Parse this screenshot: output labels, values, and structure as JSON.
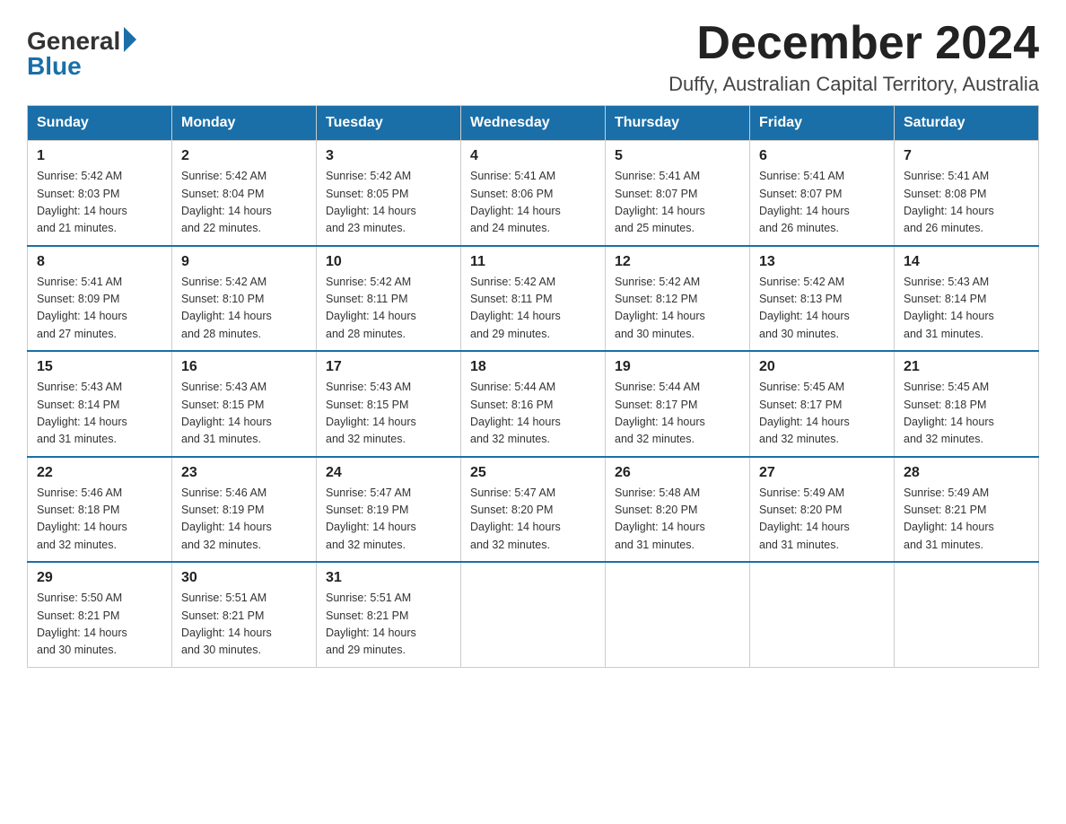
{
  "logo": {
    "general": "General",
    "blue": "Blue"
  },
  "title": "December 2024",
  "location": "Duffy, Australian Capital Territory, Australia",
  "days_of_week": [
    "Sunday",
    "Monday",
    "Tuesday",
    "Wednesday",
    "Thursday",
    "Friday",
    "Saturday"
  ],
  "weeks": [
    [
      {
        "day": "1",
        "sunrise": "5:42 AM",
        "sunset": "8:03 PM",
        "daylight": "14 hours and 21 minutes."
      },
      {
        "day": "2",
        "sunrise": "5:42 AM",
        "sunset": "8:04 PM",
        "daylight": "14 hours and 22 minutes."
      },
      {
        "day": "3",
        "sunrise": "5:42 AM",
        "sunset": "8:05 PM",
        "daylight": "14 hours and 23 minutes."
      },
      {
        "day": "4",
        "sunrise": "5:41 AM",
        "sunset": "8:06 PM",
        "daylight": "14 hours and 24 minutes."
      },
      {
        "day": "5",
        "sunrise": "5:41 AM",
        "sunset": "8:07 PM",
        "daylight": "14 hours and 25 minutes."
      },
      {
        "day": "6",
        "sunrise": "5:41 AM",
        "sunset": "8:07 PM",
        "daylight": "14 hours and 26 minutes."
      },
      {
        "day": "7",
        "sunrise": "5:41 AM",
        "sunset": "8:08 PM",
        "daylight": "14 hours and 26 minutes."
      }
    ],
    [
      {
        "day": "8",
        "sunrise": "5:41 AM",
        "sunset": "8:09 PM",
        "daylight": "14 hours and 27 minutes."
      },
      {
        "day": "9",
        "sunrise": "5:42 AM",
        "sunset": "8:10 PM",
        "daylight": "14 hours and 28 minutes."
      },
      {
        "day": "10",
        "sunrise": "5:42 AM",
        "sunset": "8:11 PM",
        "daylight": "14 hours and 28 minutes."
      },
      {
        "day": "11",
        "sunrise": "5:42 AM",
        "sunset": "8:11 PM",
        "daylight": "14 hours and 29 minutes."
      },
      {
        "day": "12",
        "sunrise": "5:42 AM",
        "sunset": "8:12 PM",
        "daylight": "14 hours and 30 minutes."
      },
      {
        "day": "13",
        "sunrise": "5:42 AM",
        "sunset": "8:13 PM",
        "daylight": "14 hours and 30 minutes."
      },
      {
        "day": "14",
        "sunrise": "5:43 AM",
        "sunset": "8:14 PM",
        "daylight": "14 hours and 31 minutes."
      }
    ],
    [
      {
        "day": "15",
        "sunrise": "5:43 AM",
        "sunset": "8:14 PM",
        "daylight": "14 hours and 31 minutes."
      },
      {
        "day": "16",
        "sunrise": "5:43 AM",
        "sunset": "8:15 PM",
        "daylight": "14 hours and 31 minutes."
      },
      {
        "day": "17",
        "sunrise": "5:43 AM",
        "sunset": "8:15 PM",
        "daylight": "14 hours and 32 minutes."
      },
      {
        "day": "18",
        "sunrise": "5:44 AM",
        "sunset": "8:16 PM",
        "daylight": "14 hours and 32 minutes."
      },
      {
        "day": "19",
        "sunrise": "5:44 AM",
        "sunset": "8:17 PM",
        "daylight": "14 hours and 32 minutes."
      },
      {
        "day": "20",
        "sunrise": "5:45 AM",
        "sunset": "8:17 PM",
        "daylight": "14 hours and 32 minutes."
      },
      {
        "day": "21",
        "sunrise": "5:45 AM",
        "sunset": "8:18 PM",
        "daylight": "14 hours and 32 minutes."
      }
    ],
    [
      {
        "day": "22",
        "sunrise": "5:46 AM",
        "sunset": "8:18 PM",
        "daylight": "14 hours and 32 minutes."
      },
      {
        "day": "23",
        "sunrise": "5:46 AM",
        "sunset": "8:19 PM",
        "daylight": "14 hours and 32 minutes."
      },
      {
        "day": "24",
        "sunrise": "5:47 AM",
        "sunset": "8:19 PM",
        "daylight": "14 hours and 32 minutes."
      },
      {
        "day": "25",
        "sunrise": "5:47 AM",
        "sunset": "8:20 PM",
        "daylight": "14 hours and 32 minutes."
      },
      {
        "day": "26",
        "sunrise": "5:48 AM",
        "sunset": "8:20 PM",
        "daylight": "14 hours and 31 minutes."
      },
      {
        "day": "27",
        "sunrise": "5:49 AM",
        "sunset": "8:20 PM",
        "daylight": "14 hours and 31 minutes."
      },
      {
        "day": "28",
        "sunrise": "5:49 AM",
        "sunset": "8:21 PM",
        "daylight": "14 hours and 31 minutes."
      }
    ],
    [
      {
        "day": "29",
        "sunrise": "5:50 AM",
        "sunset": "8:21 PM",
        "daylight": "14 hours and 30 minutes."
      },
      {
        "day": "30",
        "sunrise": "5:51 AM",
        "sunset": "8:21 PM",
        "daylight": "14 hours and 30 minutes."
      },
      {
        "day": "31",
        "sunrise": "5:51 AM",
        "sunset": "8:21 PM",
        "daylight": "14 hours and 29 minutes."
      },
      null,
      null,
      null,
      null
    ]
  ],
  "labels": {
    "sunrise": "Sunrise:",
    "sunset": "Sunset:",
    "daylight": "Daylight:"
  }
}
